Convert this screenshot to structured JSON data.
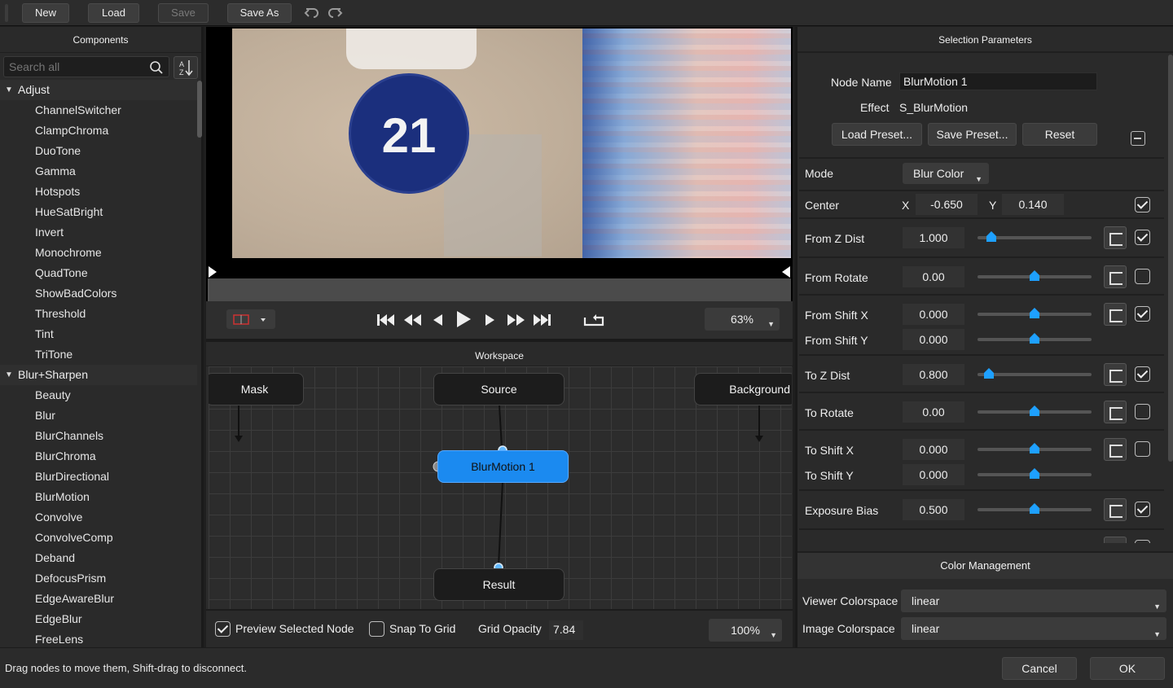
{
  "toolbar": {
    "new_label": "New",
    "load_label": "Load",
    "save_label": "Save",
    "save_as_label": "Save As"
  },
  "components": {
    "title": "Components",
    "search_placeholder": "Search all",
    "categories": [
      {
        "label": "Adjust",
        "items": [
          "ChannelSwitcher",
          "ClampChroma",
          "DuoTone",
          "Gamma",
          "Hotspots",
          "HueSatBright",
          "Invert",
          "Monochrome",
          "QuadTone",
          "ShowBadColors",
          "Threshold",
          "Tint",
          "TriTone"
        ]
      },
      {
        "label": "Blur+Sharpen",
        "items": [
          "Beauty",
          "Blur",
          "BlurChannels",
          "BlurChroma",
          "BlurDirectional",
          "BlurMotion",
          "Convolve",
          "ConvolveComp",
          "Deband",
          "DefocusPrism",
          "EdgeAwareBlur",
          "EdgeBlur",
          "FreeLens"
        ]
      }
    ]
  },
  "viewer": {
    "preview_number": "21",
    "zoom": "63%"
  },
  "workspace": {
    "title": "Workspace",
    "nodes": {
      "mask": "Mask",
      "source": "Source",
      "background": "Background",
      "selected": "BlurMotion 1",
      "result": "Result"
    },
    "preview_selected_label": "Preview Selected Node",
    "preview_selected_checked": true,
    "snap_to_grid_label": "Snap To Grid",
    "snap_to_grid_checked": false,
    "grid_opacity_label": "Grid Opacity",
    "grid_opacity_value": "7.84",
    "zoom": "100%"
  },
  "selection": {
    "title": "Selection Parameters",
    "node_name_label": "Node Name",
    "node_name_value": "BlurMotion 1",
    "effect_label": "Effect",
    "effect_value": "S_BlurMotion",
    "load_preset_label": "Load Preset...",
    "save_preset_label": "Save Preset...",
    "reset_label": "Reset",
    "mode_label": "Mode",
    "mode_value": "Blur Color",
    "center_label": "Center",
    "center_x_label": "X",
    "center_x_value": "-0.650",
    "center_y_label": "Y",
    "center_y_value": "0.140",
    "params": [
      {
        "label": "From Z Dist",
        "value": "1.000",
        "slider": 0.12,
        "checked": true
      },
      {
        "label": "From Rotate",
        "value": "0.00",
        "slider": 0.5,
        "checked": false
      },
      {
        "label": "From Shift X",
        "value": "0.000",
        "slider": 0.5,
        "checked": true
      },
      {
        "label": "From Shift Y",
        "value": "0.000",
        "slider": 0.5
      },
      {
        "label": "To Z Dist",
        "value": "0.800",
        "slider": 0.1,
        "checked": true
      },
      {
        "label": "To Rotate",
        "value": "0.00",
        "slider": 0.5,
        "checked": false
      },
      {
        "label": "To Shift X",
        "value": "0.000",
        "slider": 0.5,
        "checked": false
      },
      {
        "label": "To Shift Y",
        "value": "0.000",
        "slider": 0.5
      },
      {
        "label": "Exposure Bias",
        "value": "0.500",
        "slider": 0.5,
        "checked": true
      }
    ]
  },
  "color_management": {
    "title": "Color Management",
    "viewer_label": "Viewer Colorspace",
    "viewer_value": "linear",
    "image_label": "Image Colorspace",
    "image_value": "linear"
  },
  "status": {
    "message": "Drag nodes to move them, Shift-drag to disconnect.",
    "cancel_label": "Cancel",
    "ok_label": "OK"
  },
  "colors": {
    "accent": "#1b8af0",
    "slider_thumb": "#1ea0ff"
  }
}
